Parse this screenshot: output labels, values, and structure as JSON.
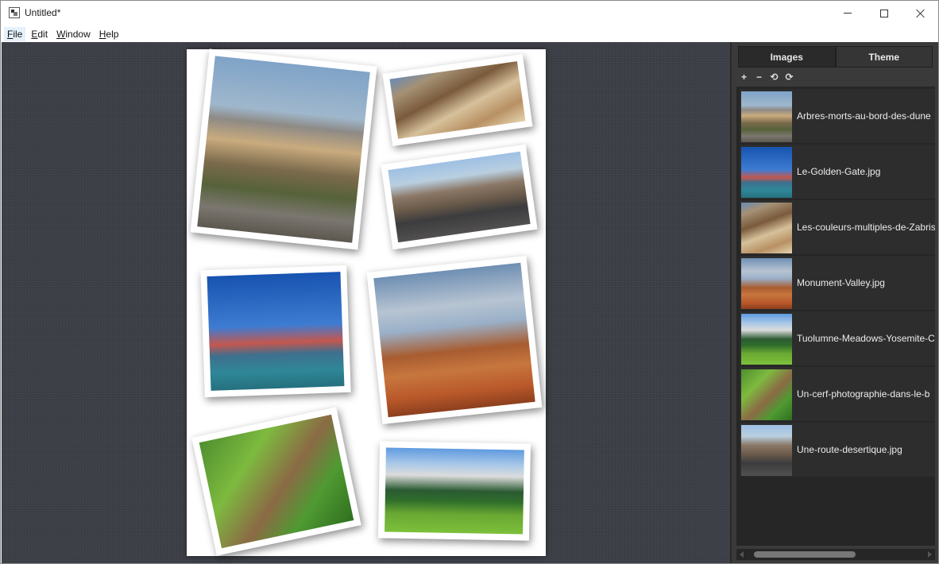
{
  "window": {
    "title": "Untitled*"
  },
  "menu": {
    "items": [
      {
        "mnemonic": "F",
        "rest": "ile"
      },
      {
        "mnemonic": "E",
        "rest": "dit"
      },
      {
        "mnemonic": "W",
        "rest": "indow"
      },
      {
        "mnemonic": "H",
        "rest": "elp"
      }
    ]
  },
  "sidebar": {
    "tabs": [
      {
        "label": "Images",
        "selected": true
      },
      {
        "label": "Theme",
        "selected": false
      }
    ],
    "toolbar": {
      "add": "+",
      "remove": "−",
      "rotate_left": "⟲",
      "rotate_right": "⟳"
    },
    "images": [
      {
        "name": "Arbres-morts-au-bord-des-dune",
        "palette": "desert"
      },
      {
        "name": "Le-Golden-Gate.jpg",
        "palette": "gate"
      },
      {
        "name": "Les-couleurs-multiples-de-Zabris",
        "palette": "zabriskie"
      },
      {
        "name": "Monument-Valley.jpg",
        "palette": "monument"
      },
      {
        "name": "Tuolumne-Meadows-Yosemite-C",
        "palette": "tuolumne"
      },
      {
        "name": "Un-cerf-photographie-dans-le-b",
        "palette": "deer"
      },
      {
        "name": "Une-route-desertique.jpg",
        "palette": "road"
      }
    ]
  },
  "canvas": {
    "photos": [
      "desert",
      "zabriskie",
      "road",
      "gate",
      "monument",
      "deer",
      "tuolumne"
    ]
  }
}
